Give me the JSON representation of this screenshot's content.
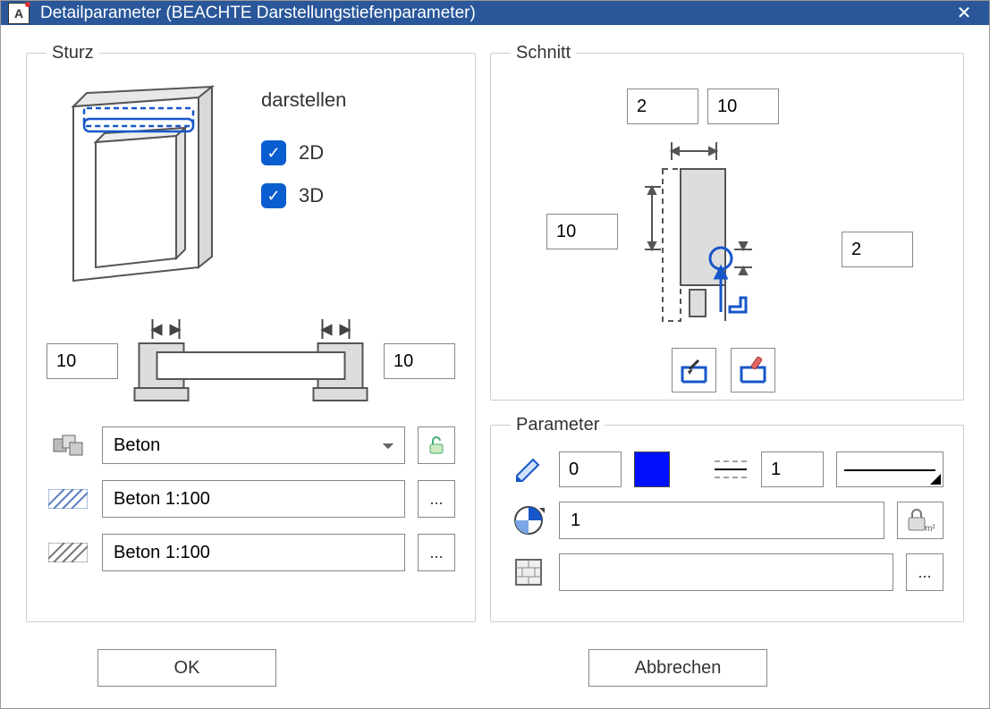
{
  "window": {
    "title": "Detailparameter (BEACHTE Darstellungstiefenparameter)",
    "app_icon_letter": "A"
  },
  "sturz": {
    "legend": "Sturz",
    "darstellen_label": "darstellen",
    "cb_2d_label": "2D",
    "cb_3d_label": "3D",
    "cb_2d_checked": true,
    "cb_3d_checked": true,
    "left_value": "10",
    "right_value": "10",
    "material_select": "Beton",
    "hatch1": "Beton 1:100",
    "hatch2": "Beton 1:100",
    "ellipsis": "..."
  },
  "schnitt": {
    "legend": "Schnitt",
    "top_left": "2",
    "top_right": "10",
    "mid_left": "10",
    "mid_right": "2"
  },
  "parameter": {
    "legend": "Parameter",
    "pen_value": "0",
    "pen_color": "#0010ff",
    "linetype_value": "1",
    "layer_value": "1",
    "surface_value": "",
    "ellipsis": "..."
  },
  "footer": {
    "ok": "OK",
    "cancel": "Abbrechen"
  }
}
